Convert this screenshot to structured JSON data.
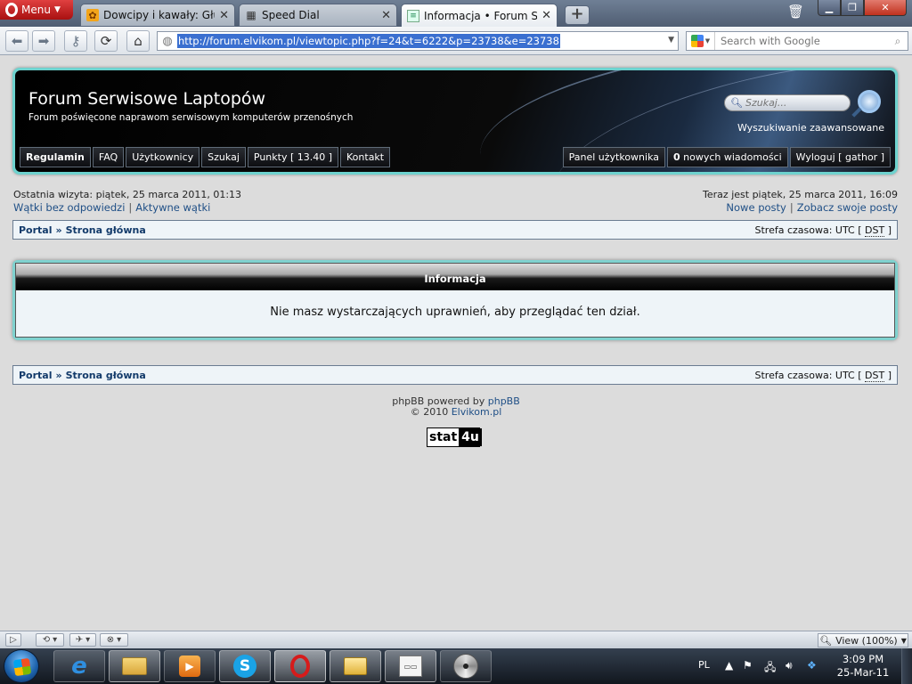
{
  "browser": {
    "menu_label": "Menu",
    "tabs": [
      {
        "title": "Dowcipy i kawały: Głupie",
        "close": "✕"
      },
      {
        "title": "Speed Dial",
        "close": "✕"
      },
      {
        "title": "Informacja • Forum Ser...",
        "close": "✕"
      }
    ],
    "new_tab": "+",
    "url": "http://forum.elvikom.pl/viewtopic.php?f=24&t=6222&p=23738&e=23738",
    "search_placeholder": "Search with Google"
  },
  "header": {
    "site_title": "Forum Serwisowe Laptopów",
    "site_description": "Forum poświęcone naprawom serwisowym komputerów przenośnych",
    "search_placeholder": "Szukaj...",
    "advanced_search": "Wyszukiwanie zaawansowane",
    "menu_left": [
      "Regulamin",
      "FAQ",
      "Użytkownicy",
      "Szukaj",
      "Punkty  [ 13.40 ]",
      "Kontakt"
    ],
    "menu_right": {
      "panel": "Panel użytkownika",
      "messages_count": "0",
      "messages_label": " nowych wiadomości",
      "logout": "Wyloguj [ gathor ]"
    }
  },
  "info": {
    "last_visit": "Ostatnia wizyta: piątek, 25 marca 2011, 01:13",
    "current_time": "Teraz jest piątek, 25 marca 2011, 16:09",
    "left_links": [
      "Wątki bez odpowiedzi",
      "Aktywne wątki"
    ],
    "right_links": [
      "Nowe posty",
      "Zobacz swoje posty"
    ],
    "separator": "|"
  },
  "breadcrumb": {
    "portal": "Portal",
    "arrow": "»",
    "home": "Strona główna",
    "timezone_prefix": "Strefa czasowa: UTC [ ",
    "dst": "DST",
    "timezone_suffix": " ]"
  },
  "panel": {
    "title": "Informacja",
    "message": "Nie masz wystarczających uprawnień, aby przeglądać ten dział."
  },
  "footer": {
    "powered_prefix": "phpBB powered by ",
    "powered_link": "phpBB",
    "copyright_prefix": "© 2010 ",
    "copyright_link": "Elvikom.pl",
    "counter_a": "stat",
    "counter_b": "4u"
  },
  "statusbar": {
    "zoom": "View (100%)"
  },
  "taskbar": {
    "language": "PL",
    "time": "3:09 PM",
    "date": "25-Mar-11"
  }
}
